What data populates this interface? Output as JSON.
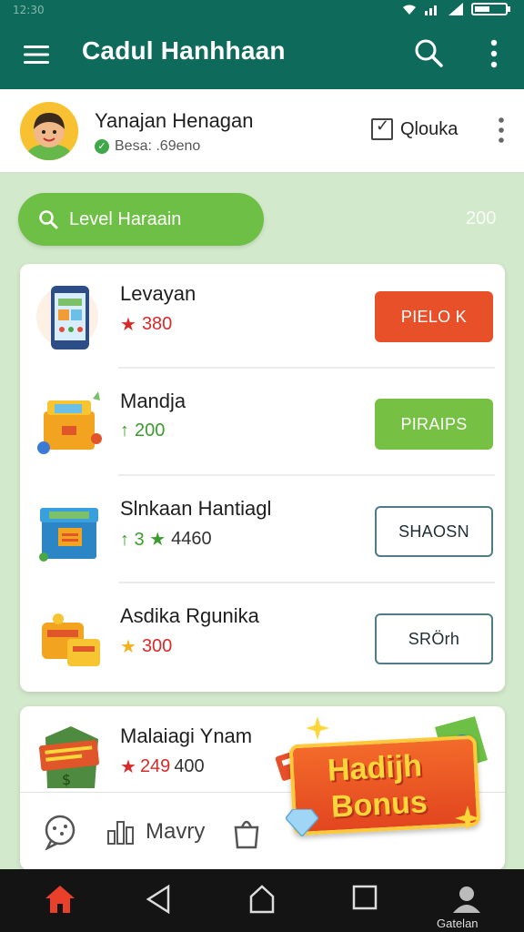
{
  "status_bar": {
    "time": "12:30",
    "wifi_icon": "wifi-icon",
    "signal_icon": "signal-icon",
    "battery_icon": "battery-icon"
  },
  "app_bar": {
    "title": "Cadul Hanhhaan",
    "menu_icon": "hamburger-menu-icon",
    "search_icon": "search-icon",
    "more_icon": "more-vertical-icon"
  },
  "profile": {
    "name": "Yanajan Henagan",
    "subtitle": "Besa: .69eno",
    "checkbox_label": "Qlouka"
  },
  "level": {
    "pill_label": "Level Haraain",
    "value": "200"
  },
  "items": [
    {
      "name": "Levayan",
      "meta_icon": "★",
      "meta_value": "380",
      "meta_color": "#d92a2a",
      "button_label": "PIELO K",
      "button_style": "red",
      "icon": "phone-icon"
    },
    {
      "name": "Mandja",
      "meta_icon": "↑",
      "meta_value": "200",
      "meta_color": "#3c9c2e",
      "button_label": "PIRAIPS",
      "button_style": "green",
      "icon": "chest-icon"
    },
    {
      "name": "Slnkaan Hantiagl",
      "meta_icon": "↑ 3 ★",
      "meta_value": "4460",
      "meta_color": "#3c9c2e",
      "button_label": "SHAOSN",
      "button_style": "outline",
      "icon": "box-icon"
    },
    {
      "name": "Asdika Rgunika",
      "meta_icon": "★",
      "meta_value": "300",
      "meta_color": "#d92a2a",
      "button_label": "SRÖrh",
      "button_style": "outline",
      "icon": "treasure-icon"
    }
  ],
  "card2": {
    "name": "Malaiagi Ynam",
    "meta_icon": "★",
    "meta_value_red": "249",
    "meta_value": "400",
    "tabs": [
      {
        "icon": "chat-icon",
        "label": ""
      },
      {
        "icon": "chart-icon",
        "label": "Mavry"
      },
      {
        "icon": "bag-icon",
        "label": ""
      }
    ]
  },
  "bonus": {
    "line1": "Hadijh",
    "line2": "Bonus"
  },
  "nav_bar": {
    "profile_label": "Gatelan"
  }
}
